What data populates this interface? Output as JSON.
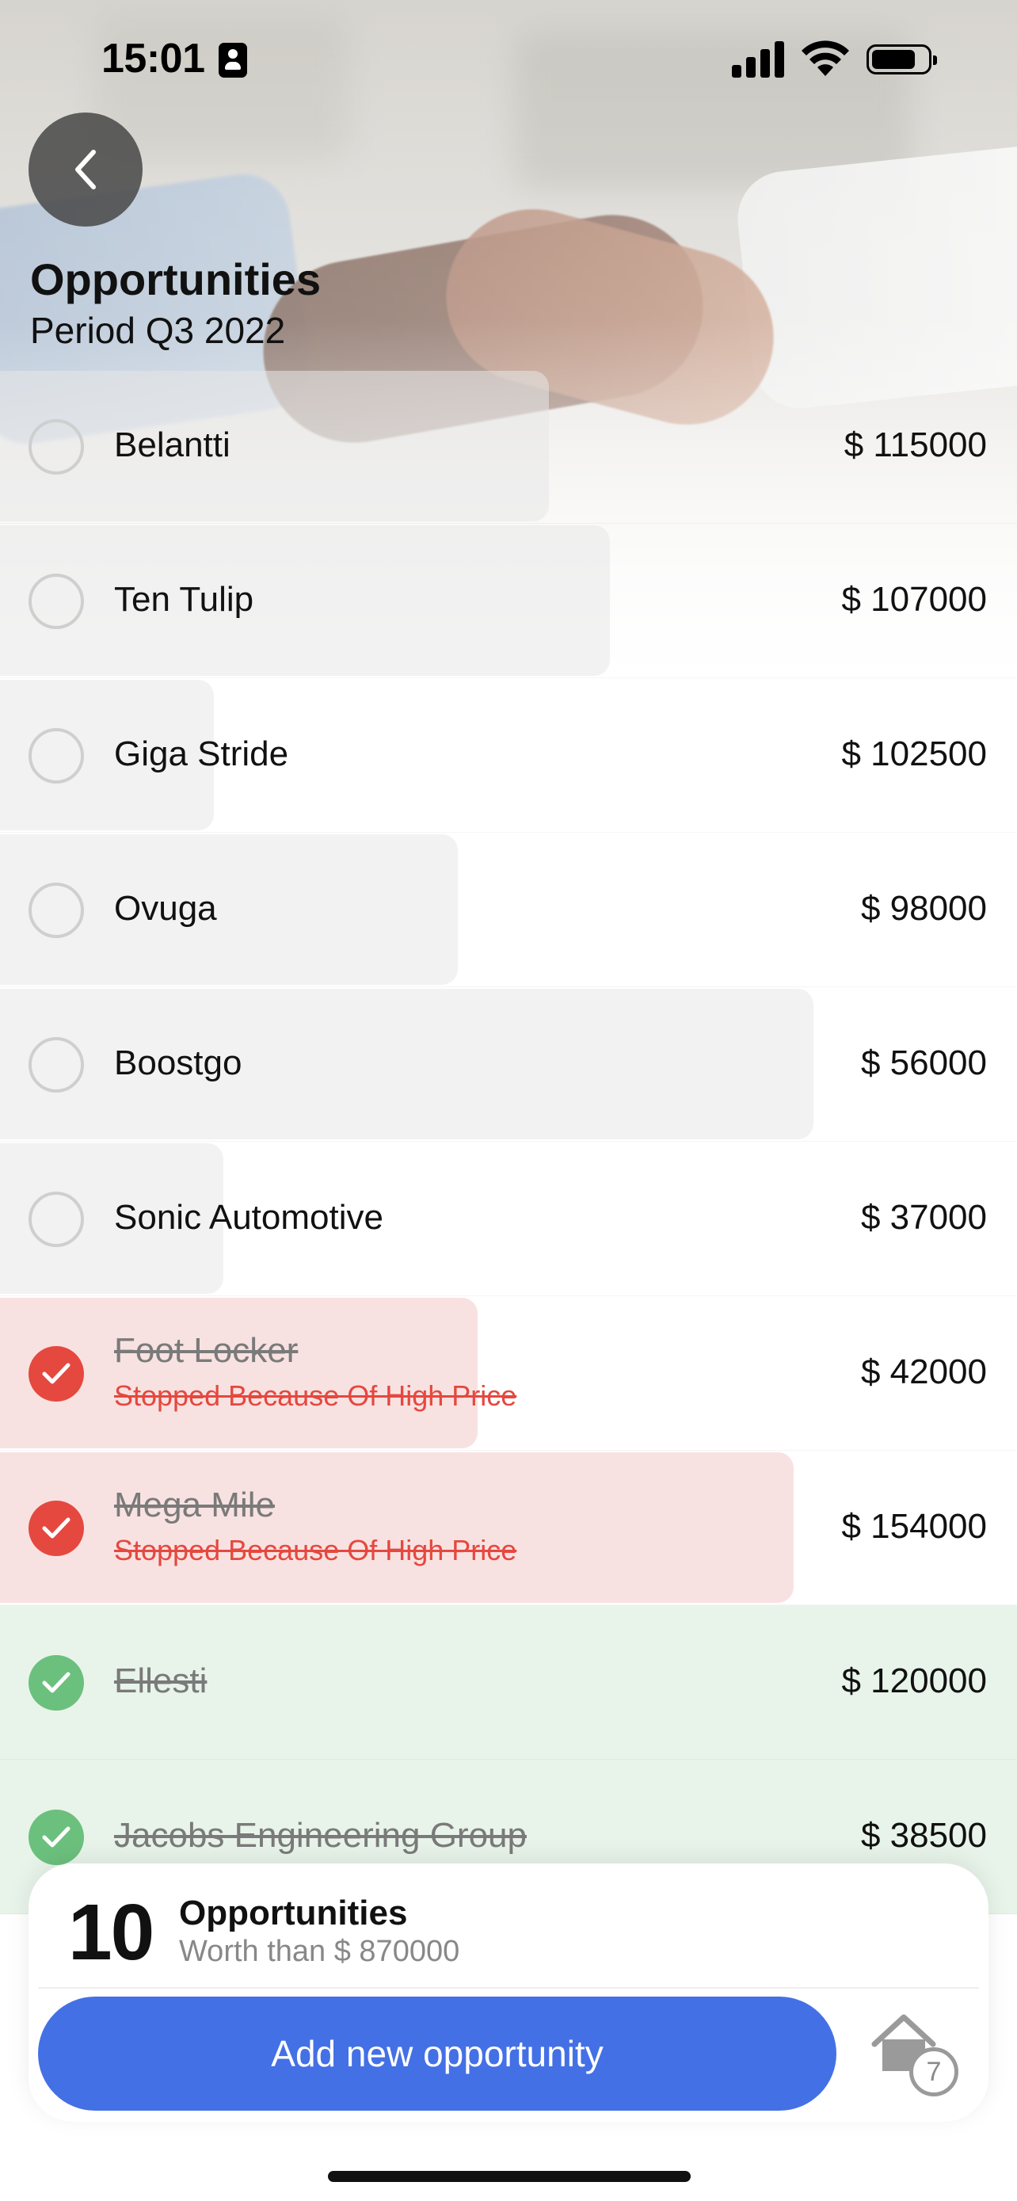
{
  "status": {
    "time": "15:01"
  },
  "header": {
    "title": "Opportunities",
    "subtitle": "Period Q3 2022"
  },
  "opportunities": [
    {
      "name": "Belantti",
      "amount": "$ 115000",
      "status": "open",
      "bar_fraction": 0.54
    },
    {
      "name": "Ten Tulip",
      "amount": "$ 107000",
      "status": "open",
      "bar_fraction": 0.6
    },
    {
      "name": "Giga Stride",
      "amount": "$ 102500",
      "status": "open",
      "bar_fraction": 0.21
    },
    {
      "name": "Ovuga",
      "amount": "$ 98000",
      "status": "open",
      "bar_fraction": 0.45
    },
    {
      "name": "Boostgo",
      "amount": "$ 56000",
      "status": "open",
      "bar_fraction": 0.8
    },
    {
      "name": "Sonic Automotive",
      "amount": "$ 37000",
      "status": "open",
      "bar_fraction": 0.22
    },
    {
      "name": "Foot Locker",
      "amount": "$ 42000",
      "status": "lost",
      "reason": "Stopped Because Of High Price",
      "bar_fraction": 0.47
    },
    {
      "name": "Mega Mile",
      "amount": "$ 154000",
      "status": "lost",
      "reason": "Stopped Because Of High Price",
      "bar_fraction": 0.78
    },
    {
      "name": "Ellesti",
      "amount": "$ 120000",
      "status": "won"
    },
    {
      "name": "Jacobs Engineering Group",
      "amount": "$ 38500",
      "status": "won"
    }
  ],
  "summary": {
    "count": "10",
    "label": "Opportunities",
    "worth": "Worth than $ 870000"
  },
  "actions": {
    "add_label": "Add new opportunity",
    "home_badge": "7"
  },
  "colors": {
    "accent": "#4470e6",
    "lost": "#e5483f",
    "won": "#6cc07d",
    "lost_bg": "#f8e2e1",
    "won_bg": "#e8f4ea"
  }
}
